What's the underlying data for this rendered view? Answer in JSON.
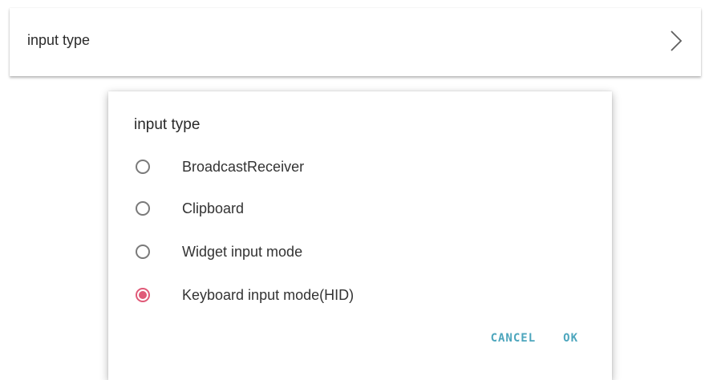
{
  "settings_row": {
    "label": "input type"
  },
  "dialog": {
    "title": "input type",
    "options": [
      {
        "label": "BroadcastReceiver",
        "selected": false
      },
      {
        "label": "Clipboard",
        "selected": false
      },
      {
        "label": "Widget input mode",
        "selected": false
      },
      {
        "label": "Keyboard input mode(HID)",
        "selected": true
      }
    ],
    "cancel_label": "CANCEL",
    "ok_label": "OK"
  },
  "colors": {
    "accent": "#e05a78",
    "button_text": "#4da6bd"
  },
  "icons": {
    "row": "chevron-right-icon"
  }
}
